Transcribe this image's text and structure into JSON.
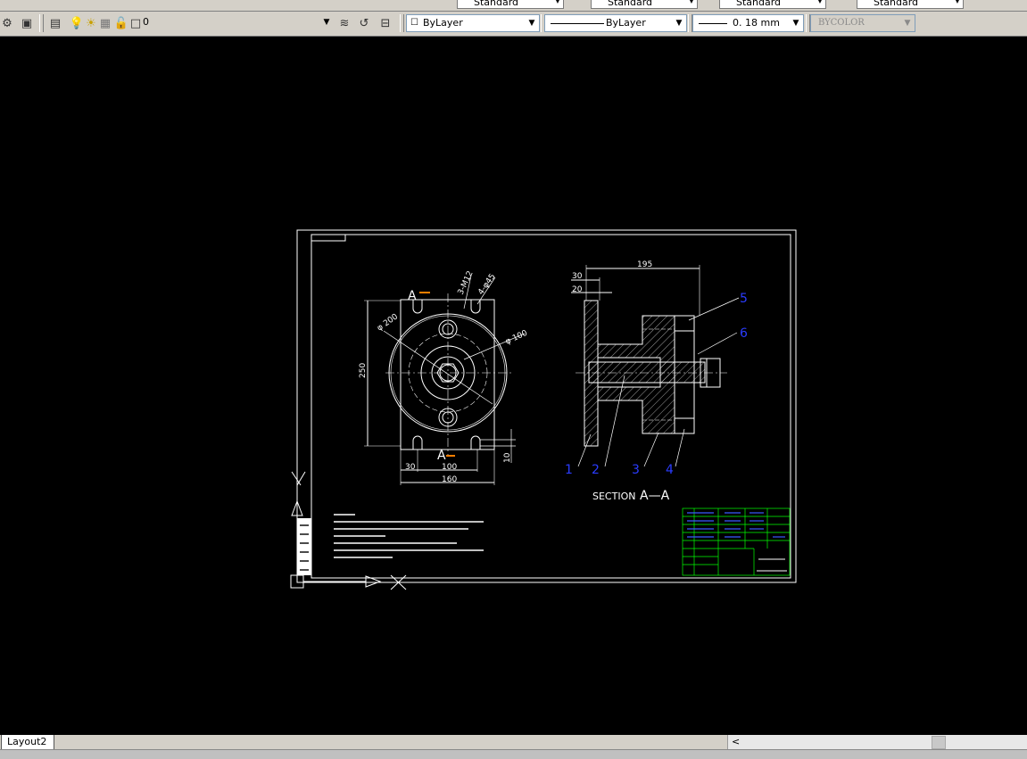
{
  "app": {
    "toolbar_top": {
      "text_style": "Standard",
      "dim_style": "Standard",
      "table_style": "Standard",
      "multileader_style": "Standard"
    },
    "layers_toolbar": {
      "layer_name": "0"
    },
    "properties_toolbar": {
      "color": "ByLayer",
      "linetype": "ByLayer",
      "lineweight": "0. 18 mm",
      "plot_style": "BYCOLOR"
    }
  },
  "drawing": {
    "front_view": {
      "section_mark_top": "A",
      "section_mark_bottom": "A",
      "dim_phi200": "φ 200",
      "dim_phi100": "φ 100",
      "dim_height": "250",
      "dim_30": "30",
      "dim_100": "100",
      "dim_160": "160",
      "dim_10": "10",
      "leader_hole_1": "3-M12",
      "leader_hole_2": "4-φ45"
    },
    "section_view": {
      "dim_195": "195",
      "dim_30": "30",
      "dim_20": "20",
      "balloons": [
        "1",
        "2",
        "3",
        "4",
        "5",
        "6"
      ],
      "caption": "SECTION",
      "caption_id": "A—A"
    }
  },
  "statusbar": {
    "layout_tab": "Layout2",
    "scroll_left": "<"
  },
  "colors": {
    "drawing_line": "#ffffff",
    "balloon": "#1a1aff",
    "title_block": "#00ff00",
    "canvas": "#000000",
    "ui_gray": "#d4d0c8"
  }
}
